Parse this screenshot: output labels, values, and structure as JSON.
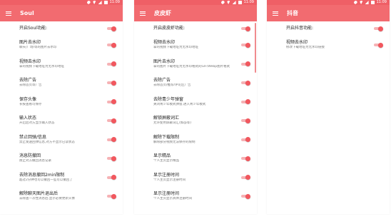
{
  "status": {
    "time": "11:09"
  },
  "accent": "#f26b70",
  "screens": [
    {
      "title": "Soul",
      "items": [
        {
          "title": "开启Soul功能:",
          "sub": ""
        },
        {
          "title": "图片去水印",
          "sub": "聊天/广场/等的图片去水印"
        },
        {
          "title": "视频去水印",
          "sub": "拿的视频下载地址为无水印地址"
        },
        {
          "title": "去除广告",
          "sub": "去除首页等广告"
        },
        {
          "title": "保存头像",
          "sub": "长按查看可保存"
        },
        {
          "title": "输入状态",
          "sub": "开启后对方显示输入状态"
        },
        {
          "title": "禁止回弹/信息",
          "sub": "禁止发送回弹信息,对方不显示已读状态"
        },
        {
          "title": "消息防撤回",
          "sub": "防止对方撤回消息记录"
        },
        {
          "title": "去除消息撤回2min限制",
          "sub": "超过2分钟也可以撤回一些可以撤回了"
        },
        {
          "title": "解除聊天图片退出后",
          "sub": "去除查一次性消息后,显示必要更新头像"
        }
      ]
    },
    {
      "title": "皮皮虾",
      "items": [
        {
          "title": "开启皮皮虾功能:",
          "sub": ""
        },
        {
          "title": "视频去水印",
          "sub": "拿的视频下载地址为无水印地址"
        },
        {
          "title": "图片去水印",
          "sub": "拿的图片下载地址为无水印格式的GIF/Webp图片格式"
        },
        {
          "title": "去除广告",
          "sub": "去除首页/推荐/评论区广告"
        },
        {
          "title": "去除青少年弹窗",
          "sub": "关闭青少年模式弹窗,进入青少年模式"
        },
        {
          "title": "解锁屏蔽词汇",
          "sub": "允许使用屏蔽词汇(如@等)"
        },
        {
          "title": "解除下载限制",
          "sub": "解除部分视频无法保存的限制"
        },
        {
          "title": "显示精品",
          "sub": "个人主页显示精品"
        },
        {
          "title": "显示注册时间",
          "sub": "个人主页显示注册时间"
        },
        {
          "title": "显示注册时间",
          "sub": "个人主页显示具体注册时间"
        }
      ]
    },
    {
      "title": "抖音",
      "items": [
        {
          "title": "开启抖音功能:",
          "sub": ""
        },
        {
          "title": "视频去水印",
          "sub": "修改下载地址为无水印链接"
        }
      ]
    }
  ]
}
